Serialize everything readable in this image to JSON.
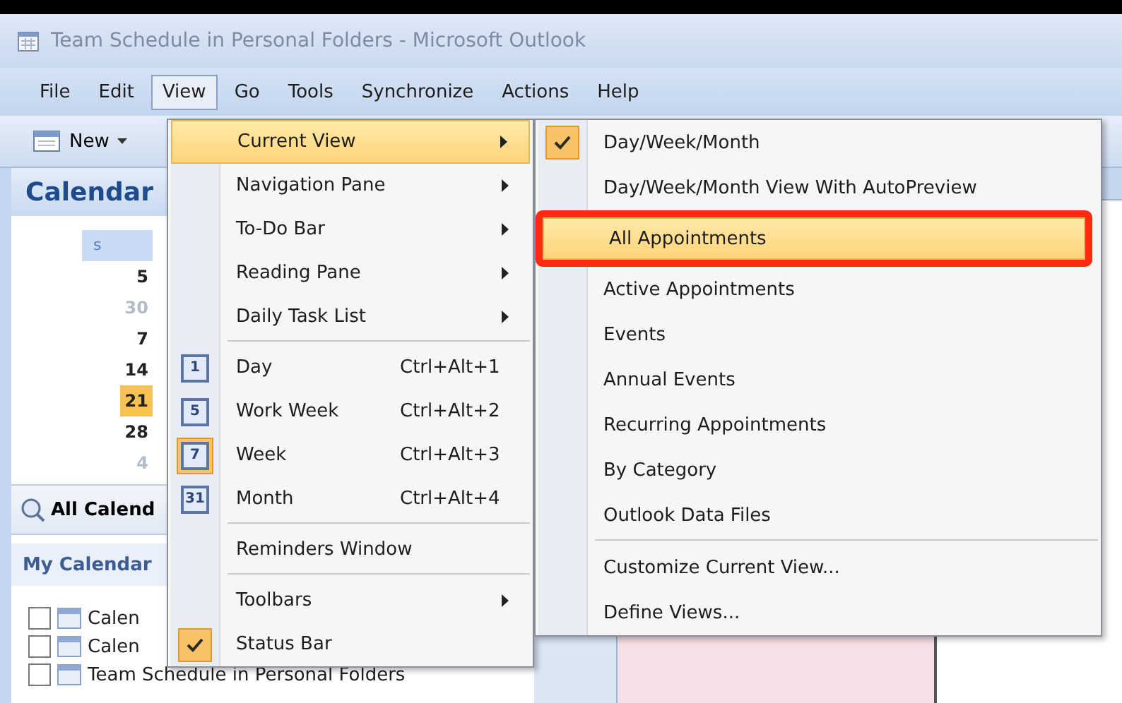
{
  "window": {
    "title": "Team Schedule in Personal Folders - Microsoft Outlook"
  },
  "menubar": [
    {
      "label": "File",
      "selected": false
    },
    {
      "label": "Edit",
      "selected": false
    },
    {
      "label": "View",
      "selected": true
    },
    {
      "label": "Go",
      "selected": false
    },
    {
      "label": "Tools",
      "selected": false
    },
    {
      "label": "Synchronize",
      "selected": false
    },
    {
      "label": "Actions",
      "selected": false
    },
    {
      "label": "Help",
      "selected": false
    }
  ],
  "toolbar": {
    "new_button": "New"
  },
  "nav_pane": {
    "title": "Calendar",
    "mini_calendar": {
      "header": "s",
      "days": [
        {
          "label": "5",
          "kind": "current"
        },
        {
          "label": "30",
          "kind": "other"
        },
        {
          "label": "7",
          "kind": "current"
        },
        {
          "label": "14",
          "kind": "current"
        },
        {
          "label": "21",
          "kind": "today"
        },
        {
          "label": "28",
          "kind": "current"
        },
        {
          "label": "4",
          "kind": "other"
        }
      ]
    },
    "all_calendars_button": "All Calend",
    "my_calendars": {
      "title": "My Calendar",
      "items": [
        {
          "label": "Calen",
          "checked": false
        },
        {
          "label": "Calen",
          "checked": false
        },
        {
          "label": "Team Schedule in Personal Folders",
          "checked": false
        }
      ]
    }
  },
  "view_menu": {
    "groups": [
      [
        {
          "kind": "submenu",
          "label": "Current View",
          "selected": true
        },
        {
          "kind": "submenu",
          "label": "Navigation Pane",
          "selected": false
        },
        {
          "kind": "submenu",
          "label": "To-Do Bar",
          "selected": false
        },
        {
          "kind": "submenu",
          "label": "Reading Pane",
          "selected": false
        },
        {
          "kind": "submenu",
          "label": "Daily Task List",
          "selected": false
        }
      ],
      [
        {
          "kind": "view",
          "label": "Day",
          "icon_text": "1",
          "shortcut": "Ctrl+Alt+1",
          "selected": false,
          "checked": false
        },
        {
          "kind": "view",
          "label": "Work Week",
          "icon_text": "5",
          "shortcut": "Ctrl+Alt+2",
          "selected": false,
          "checked": false
        },
        {
          "kind": "view",
          "label": "Week",
          "icon_text": "7",
          "shortcut": "Ctrl+Alt+3",
          "selected": false,
          "checked": true
        },
        {
          "kind": "view",
          "label": "Month",
          "icon_text": "31",
          "shortcut": "Ctrl+Alt+4",
          "selected": false,
          "checked": false
        }
      ],
      [
        {
          "kind": "command",
          "label": "Reminders Window",
          "selected": false
        }
      ],
      [
        {
          "kind": "submenu",
          "label": "Toolbars",
          "selected": false
        },
        {
          "kind": "check",
          "label": "Status Bar",
          "selected": false,
          "checked": true
        }
      ]
    ]
  },
  "current_view_submenu": {
    "groups": [
      [
        {
          "label": "Day/Week/Month",
          "checked": true,
          "selected": false,
          "annotated": false
        },
        {
          "label": "Day/Week/Month View With AutoPreview",
          "checked": false,
          "selected": false,
          "annotated": false
        },
        {
          "label": "All Appointments",
          "checked": false,
          "selected": true,
          "annotated": true
        },
        {
          "label": "Active Appointments",
          "checked": false,
          "selected": false,
          "annotated": false
        },
        {
          "label": "Events",
          "checked": false,
          "selected": false,
          "annotated": false
        },
        {
          "label": "Annual Events",
          "checked": false,
          "selected": false,
          "annotated": false
        },
        {
          "label": "Recurring Appointments",
          "checked": false,
          "selected": false,
          "annotated": false
        },
        {
          "label": "By Category",
          "checked": false,
          "selected": false,
          "annotated": false
        },
        {
          "label": "Outlook Data Files",
          "checked": false,
          "selected": false,
          "annotated": false
        }
      ],
      [
        {
          "label": "Customize Current View...",
          "checked": false,
          "selected": false,
          "annotated": false
        },
        {
          "label": "Define Views...",
          "checked": false,
          "selected": false,
          "annotated": false
        }
      ]
    ]
  }
}
